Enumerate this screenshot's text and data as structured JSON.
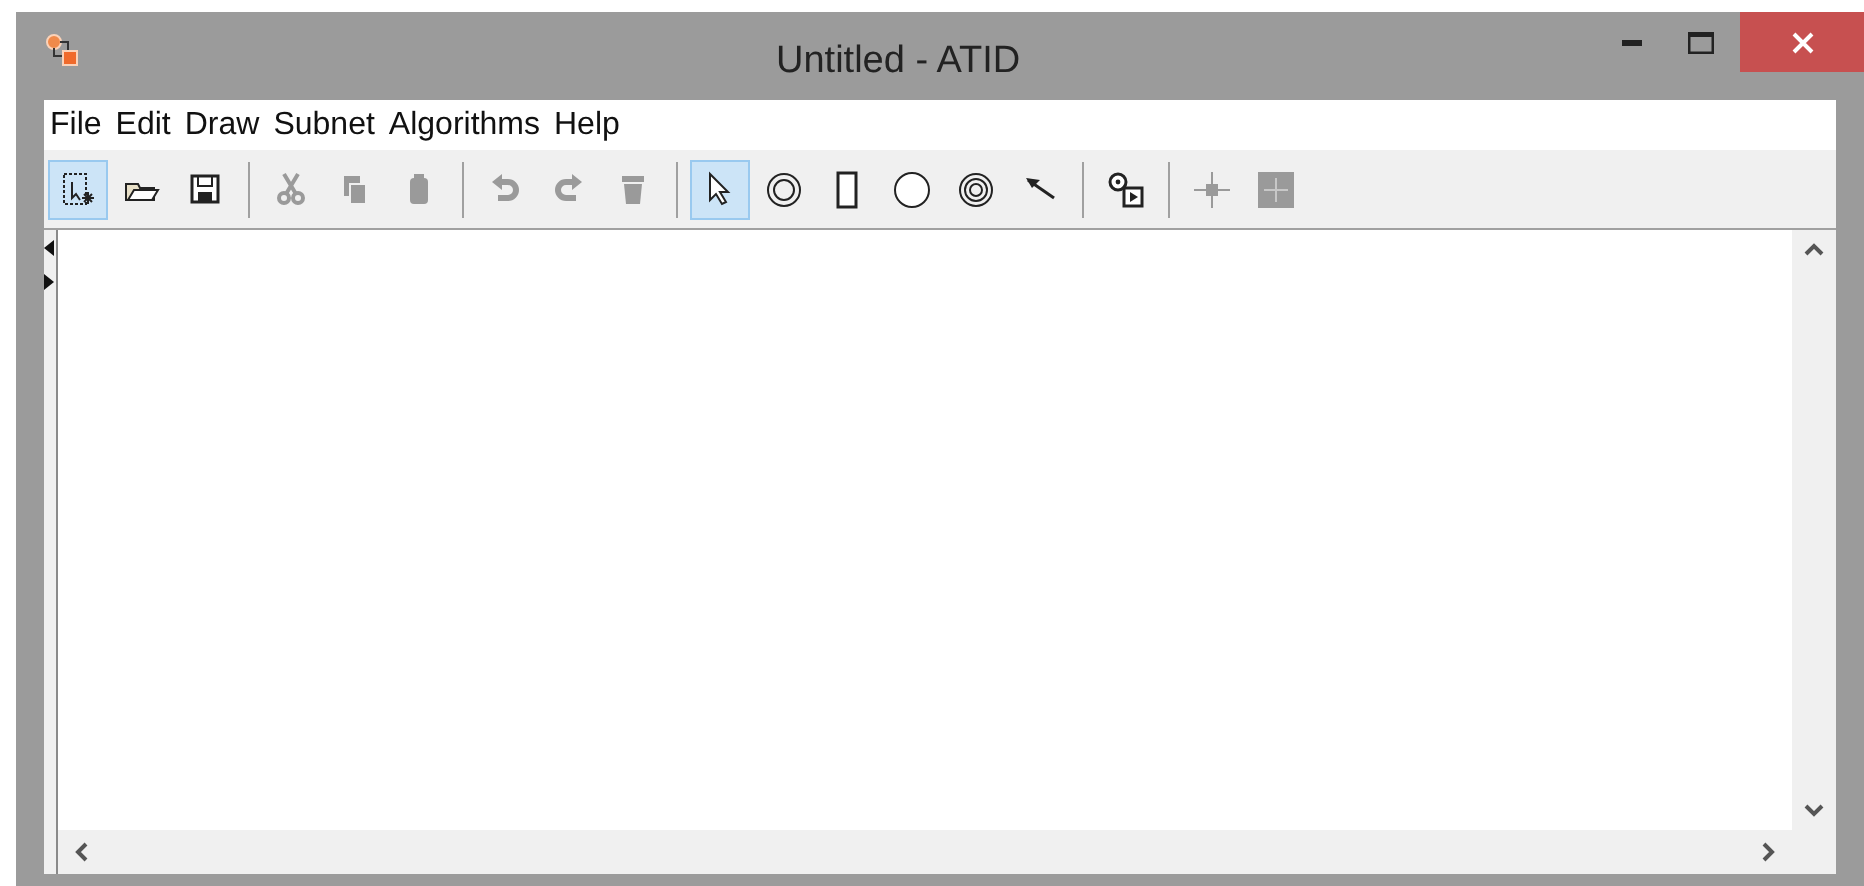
{
  "window": {
    "title": "Untitled - ATID"
  },
  "menu": [
    "File",
    "Edit",
    "Draw",
    "Subnet",
    "Algorithms",
    "Help"
  ],
  "toolbar": [
    [
      {
        "kind": "new",
        "selected": true,
        "disabled": false
      },
      {
        "kind": "open",
        "selected": false,
        "disabled": false
      },
      {
        "kind": "save",
        "selected": false,
        "disabled": false
      }
    ],
    [
      {
        "kind": "cut",
        "selected": false,
        "disabled": true
      },
      {
        "kind": "copy",
        "selected": false,
        "disabled": true
      },
      {
        "kind": "paste",
        "selected": false,
        "disabled": true
      }
    ],
    [
      {
        "kind": "undo",
        "selected": false,
        "disabled": true
      },
      {
        "kind": "redo",
        "selected": false,
        "disabled": true
      },
      {
        "kind": "delete",
        "selected": false,
        "disabled": true
      }
    ],
    [
      {
        "kind": "pointer",
        "selected": true,
        "disabled": false
      },
      {
        "kind": "double-circle",
        "selected": false,
        "disabled": false
      },
      {
        "kind": "rectangle",
        "selected": false,
        "disabled": false
      },
      {
        "kind": "circle",
        "selected": false,
        "disabled": false
      },
      {
        "kind": "triple-circle",
        "selected": false,
        "disabled": false
      },
      {
        "kind": "arrow",
        "selected": false,
        "disabled": false
      }
    ],
    [
      {
        "kind": "subnet",
        "selected": false,
        "disabled": false
      }
    ],
    [
      {
        "kind": "shrink",
        "selected": false,
        "disabled": true
      },
      {
        "kind": "expand",
        "selected": false,
        "disabled": true
      }
    ]
  ]
}
